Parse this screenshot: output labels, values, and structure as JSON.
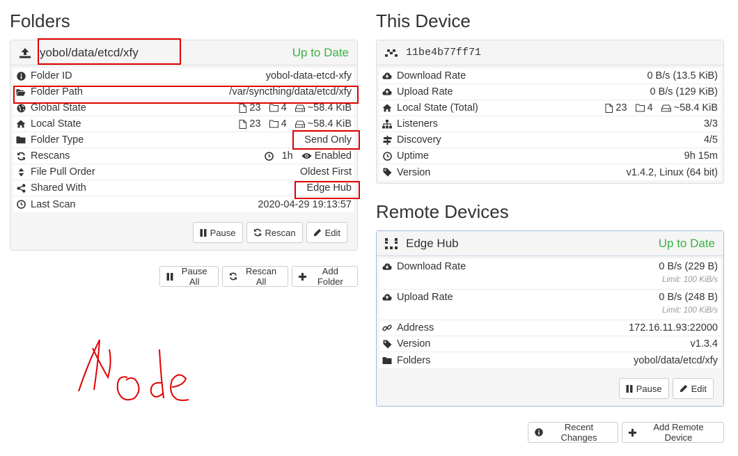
{
  "folders": {
    "heading": "Folders",
    "folder": {
      "title": "yobol/data/etcd/xfy",
      "status": "Up to Date",
      "rows": [
        {
          "icon": "info-icon",
          "label": "Folder ID",
          "value": "yobol-data-etcd-xfy"
        },
        {
          "icon": "folder-open-icon",
          "label": "Folder Path",
          "value": "/var/syncthing/data/etcd/xfy"
        },
        {
          "icon": "globe-icon",
          "label": "Global State",
          "files": "23",
          "dirs": "4",
          "size": "~58.4 KiB"
        },
        {
          "icon": "home-icon",
          "label": "Local State",
          "files": "23",
          "dirs": "4",
          "size": "~58.4 KiB"
        },
        {
          "icon": "folder-icon",
          "label": "Folder Type",
          "value": "Send Only"
        },
        {
          "icon": "refresh-icon",
          "label": "Rescans",
          "interval": "1h",
          "watch": "Enabled"
        },
        {
          "icon": "sort-icon",
          "label": "File Pull Order",
          "value": "Oldest First"
        },
        {
          "icon": "share-icon",
          "label": "Shared With",
          "value": "Edge Hub"
        },
        {
          "icon": "clock-icon",
          "label": "Last Scan",
          "value": "2020-04-29 19:13:57"
        }
      ],
      "buttons": {
        "pause": "Pause",
        "rescan": "Rescan",
        "edit": "Edit"
      }
    },
    "actions": {
      "pause_all": "Pause All",
      "rescan_all": "Rescan All",
      "add_folder": "Add Folder"
    }
  },
  "this_device": {
    "heading": "This Device",
    "id": "11be4b77ff71",
    "rows": [
      {
        "icon": "cloud-download-icon",
        "label": "Download Rate",
        "value": "0 B/s (13.5 KiB)"
      },
      {
        "icon": "cloud-upload-icon",
        "label": "Upload Rate",
        "value": "0 B/s (129 KiB)"
      },
      {
        "icon": "home-icon",
        "label": "Local State (Total)",
        "files": "23",
        "dirs": "4",
        "size": "~58.4 KiB"
      },
      {
        "icon": "sitemap-icon",
        "label": "Listeners",
        "value": "3/3"
      },
      {
        "icon": "signpost-icon",
        "label": "Discovery",
        "value": "4/5"
      },
      {
        "icon": "clock-icon",
        "label": "Uptime",
        "value": "9h 15m"
      },
      {
        "icon": "tag-icon",
        "label": "Version",
        "value": "v1.4.2, Linux (64 bit)"
      }
    ]
  },
  "remote_devices": {
    "heading": "Remote Devices",
    "device": {
      "name": "Edge Hub",
      "status": "Up to Date",
      "rows": [
        {
          "icon": "cloud-download-icon",
          "label": "Download Rate",
          "value": "0 B/s (229 B)",
          "limit": "Limit: 100 KiB/s"
        },
        {
          "icon": "cloud-upload-icon",
          "label": "Upload Rate",
          "value": "0 B/s (248 B)",
          "limit": "Limit: 100 KiB/s"
        },
        {
          "icon": "link-icon",
          "label": "Address",
          "value": "172.16.11.93:22000"
        },
        {
          "icon": "tag-icon",
          "label": "Version",
          "value": "v1.3.4"
        },
        {
          "icon": "folder-icon",
          "label": "Folders",
          "value": "yobol/data/etcd/xfy"
        }
      ],
      "buttons": {
        "pause": "Pause",
        "edit": "Edit"
      }
    },
    "actions": {
      "recent_changes": "Recent Changes",
      "add_remote": "Add Remote Device"
    }
  },
  "annotation": {
    "handwritten_text": "Node",
    "color": "#e00000"
  },
  "colors": {
    "ok_green": "#3cb043",
    "highlight_red": "#e00000"
  }
}
